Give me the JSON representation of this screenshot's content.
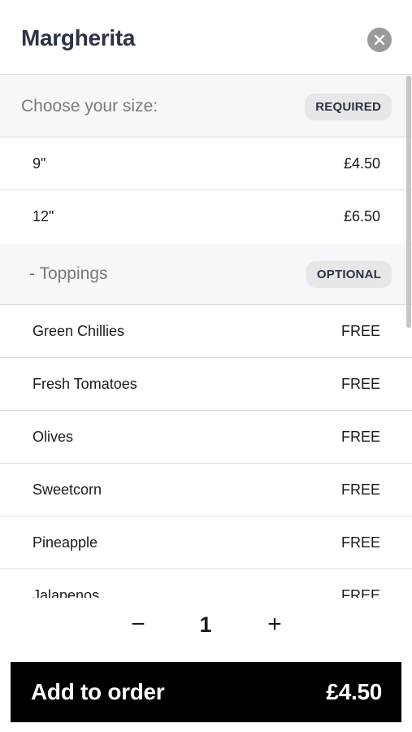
{
  "header": {
    "title": "Margherita",
    "close_icon": "close-icon"
  },
  "size_section": {
    "label": "Choose your size:",
    "badge": "REQUIRED",
    "options": [
      {
        "name": "9\"",
        "price": "£4.50"
      },
      {
        "name": "12\"",
        "price": "£6.50"
      }
    ]
  },
  "toppings_section": {
    "label": "- Toppings",
    "badge": "OPTIONAL",
    "options": [
      {
        "name": "Green Chillies",
        "price": "FREE"
      },
      {
        "name": "Fresh Tomatoes",
        "price": "FREE"
      },
      {
        "name": "Olives",
        "price": "FREE"
      },
      {
        "name": "Sweetcorn",
        "price": "FREE"
      },
      {
        "name": "Pineapple",
        "price": "FREE"
      },
      {
        "name": "Jalapenos",
        "price": "FREE"
      }
    ]
  },
  "quantity": {
    "minus": "−",
    "value": "1",
    "plus": "+"
  },
  "add_button": {
    "label": "Add to order",
    "price": "£4.50"
  },
  "colors": {
    "title": "#2c3345",
    "button_bg": "#000000",
    "section_bg": "#f5f7f9"
  }
}
